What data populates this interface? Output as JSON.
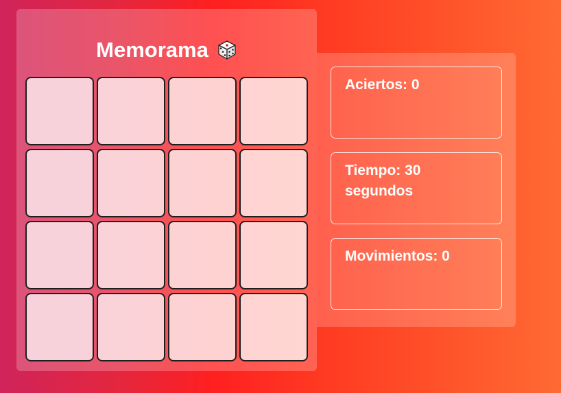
{
  "game": {
    "title": "Memorama",
    "title_icon": "die-icon",
    "cards": [
      {
        "id": 1,
        "state": "face-down"
      },
      {
        "id": 2,
        "state": "face-down"
      },
      {
        "id": 3,
        "state": "face-down"
      },
      {
        "id": 4,
        "state": "face-down"
      },
      {
        "id": 5,
        "state": "face-down"
      },
      {
        "id": 6,
        "state": "face-down"
      },
      {
        "id": 7,
        "state": "face-down"
      },
      {
        "id": 8,
        "state": "face-down"
      },
      {
        "id": 9,
        "state": "face-down"
      },
      {
        "id": 10,
        "state": "face-down"
      },
      {
        "id": 11,
        "state": "face-down"
      },
      {
        "id": 12,
        "state": "face-down"
      },
      {
        "id": 13,
        "state": "face-down"
      },
      {
        "id": 14,
        "state": "face-down"
      },
      {
        "id": 15,
        "state": "face-down"
      },
      {
        "id": 16,
        "state": "face-down"
      }
    ]
  },
  "stats": {
    "hits": "Aciertos: 0",
    "time": "Tiempo: 30 segundos",
    "moves": "Movimientos: 0"
  },
  "colors": {
    "background_start": "#d0245a",
    "background_mid": "#ff2020",
    "background_end": "#ff6a33",
    "card_border": "#1e1e1e",
    "text": "#ffffff"
  }
}
